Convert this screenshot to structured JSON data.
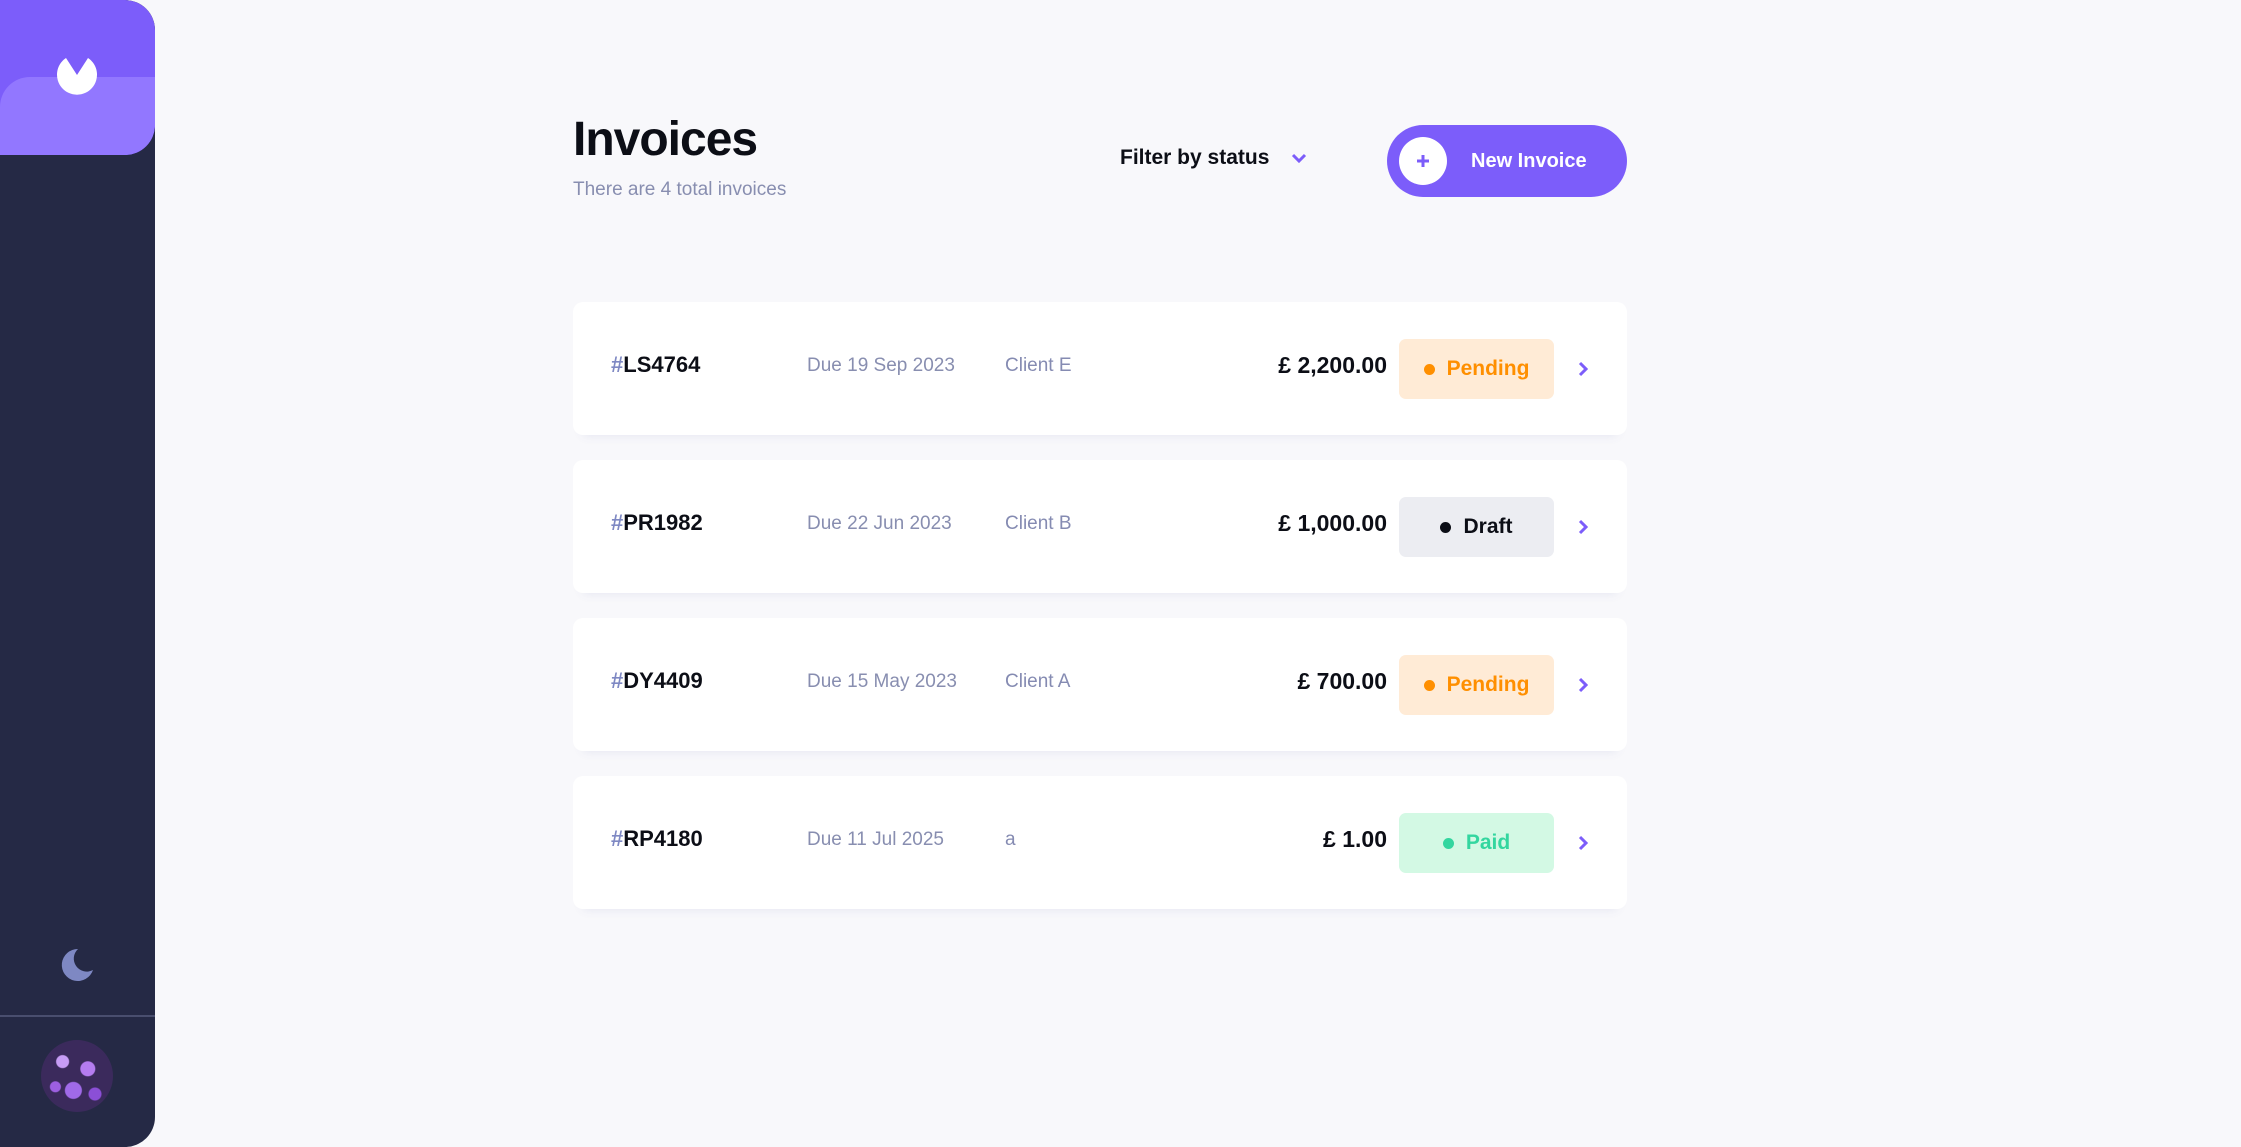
{
  "header": {
    "title": "Invoices",
    "subtitle": "There are 4 total invoices",
    "filter_label": "Filter by status",
    "new_invoice_label": "New Invoice"
  },
  "icons": {
    "logo": "logo-icon",
    "theme_toggle": "moon-icon",
    "filter": "chevron-down-icon",
    "new_invoice": "plus-icon",
    "row": "chevron-right-icon"
  },
  "colors": {
    "accent": "#7C5DFA",
    "sidebar": "#252945",
    "pending": "#FF8F00",
    "paid": "#33D69F",
    "draft": "#373B53"
  },
  "invoices": [
    {
      "hash": "#",
      "id": "LS4764",
      "due": "Due 19 Sep 2023",
      "client": "Client E",
      "amount": "£ 2,200.00",
      "status": "Pending",
      "status_key": "pending"
    },
    {
      "hash": "#",
      "id": "PR1982",
      "due": "Due 22 Jun 2023",
      "client": "Client B",
      "amount": "£ 1,000.00",
      "status": "Draft",
      "status_key": "draft"
    },
    {
      "hash": "#",
      "id": "DY4409",
      "due": "Due 15 May 2023",
      "client": "Client A",
      "amount": "£ 700.00",
      "status": "Pending",
      "status_key": "pending"
    },
    {
      "hash": "#",
      "id": "RP4180",
      "due": "Due 11 Jul 2025",
      "client": "a",
      "amount": "£ 1.00",
      "status": "Paid",
      "status_key": "paid"
    }
  ]
}
